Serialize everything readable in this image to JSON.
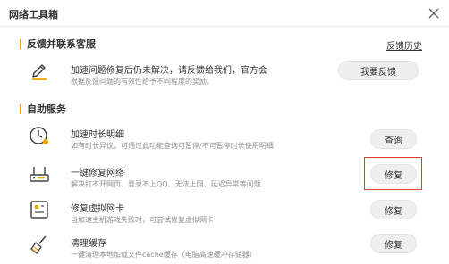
{
  "window": {
    "title": "网络工具箱"
  },
  "feedback_section": {
    "heading": "反馈并联系客服",
    "history_link": "反馈历史",
    "title": "加速问题修复后仍未解决，请反馈给我们，官方会",
    "desc": "根据反馈问题的有效性给予不同程度的奖励。",
    "button": "我要反馈"
  },
  "self_service": {
    "heading": "自助服务",
    "items": [
      {
        "icon": "clock-icon",
        "title": "加速时长明细",
        "desc": "如有时长异议，可通过此功能查询可暂停/不可暂停时长使用明细",
        "button": "查询"
      },
      {
        "icon": "router-icon",
        "title": "一键修复网络",
        "desc": "解决打不开网页、登录不上QQ、无法上网、延迟异常等问题",
        "button": "修复"
      },
      {
        "icon": "network-card-icon",
        "title": "修复虚拟网卡",
        "desc": "当加速主机游戏失败时，可尝试修复虚拟网卡",
        "button": "修复"
      },
      {
        "icon": "broom-icon",
        "title": "清理缓存",
        "desc": "一键清理本地加载文件cache缓存（电脑高速缓冲存储器）",
        "button": "修复"
      }
    ]
  },
  "colors": {
    "accent": "#f5a500",
    "highlight": "#e23b2e",
    "button_bg": "#efefef"
  }
}
